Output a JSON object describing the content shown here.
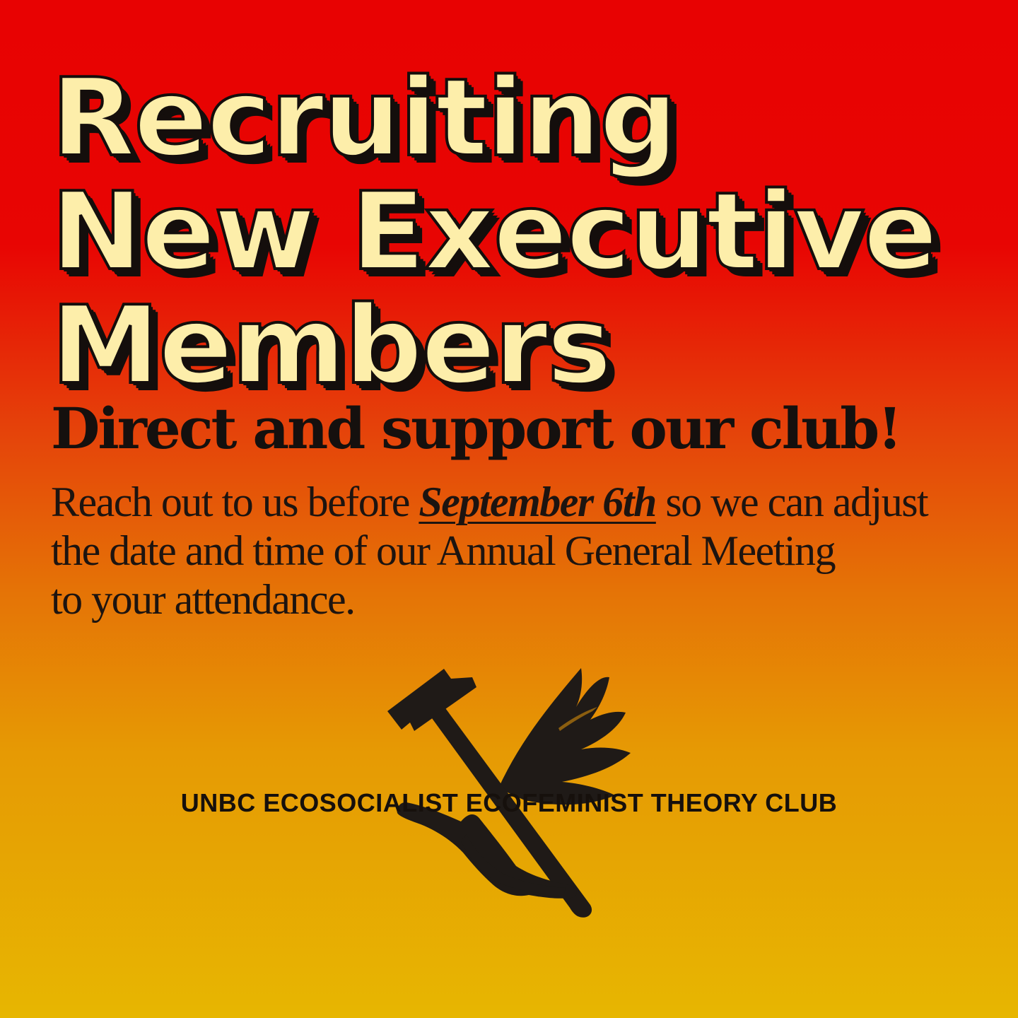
{
  "headline": {
    "line1": "Recruiting",
    "line2": "New Executive",
    "line3": "Members"
  },
  "subhead": "Direct and support our club!",
  "body": {
    "before_date": "Reach out to us before ",
    "date": "September 6th",
    "after_date": " so we can adjust",
    "line2": "the date and time of our Annual General Meeting",
    "line3": "to your attendance."
  },
  "emblem": {
    "icon": "hammer-and-hand-with-bird-wing-icon",
    "color": "#1f1a17"
  },
  "footer": {
    "club_name": "UNBC ECOSOCIALIST ECOFEMINIST THEORY CLUB"
  },
  "colors": {
    "gradient_top": "#e80202",
    "gradient_bottom": "#e7b601",
    "headline_fill": "#fdeeaa",
    "outline": "#140e0c"
  }
}
